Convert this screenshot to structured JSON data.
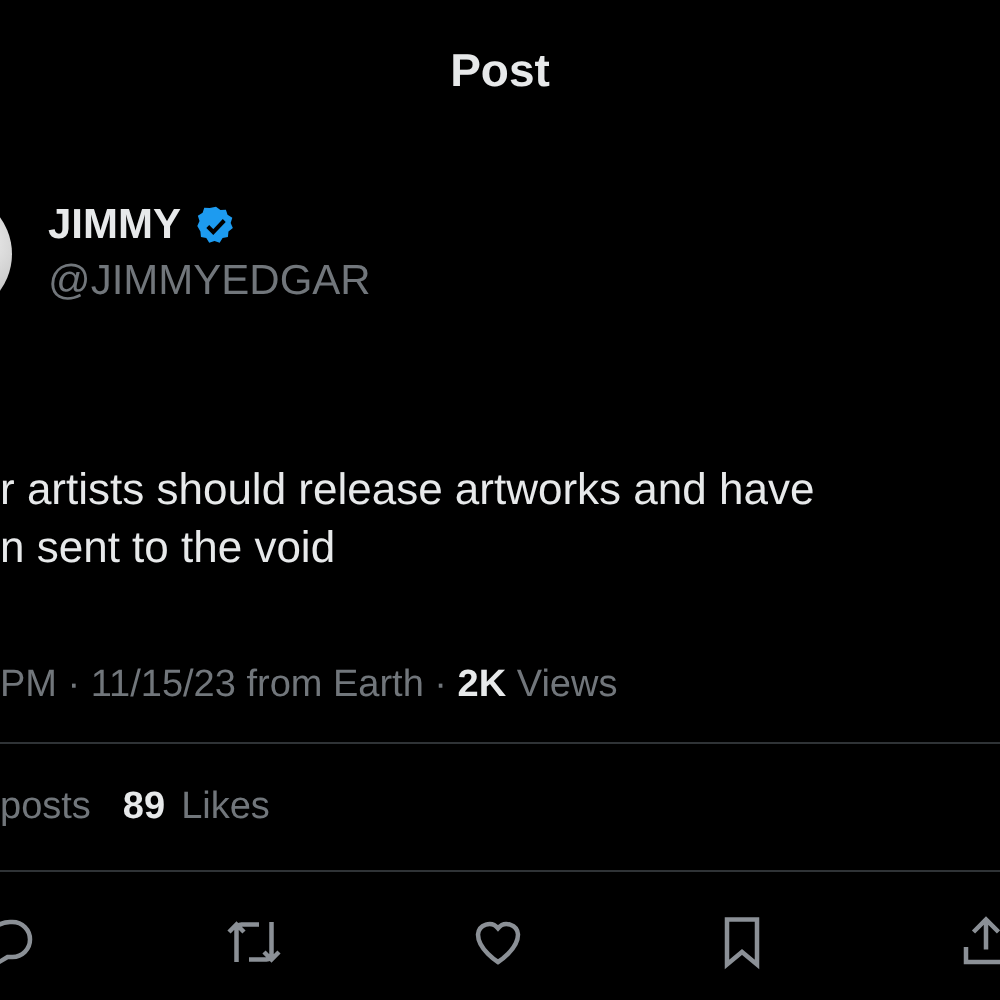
{
  "header": {
    "title": "Post"
  },
  "author": {
    "name": "JIMMY",
    "verified": true,
    "handle": "@JIMMYEDGAR"
  },
  "body": [
    "r artists should release artworks and have",
    "n sent to the void"
  ],
  "meta": {
    "time": "PM · 11/15/23 from Earth · ",
    "views_count": "2K",
    "views_label": " Views"
  },
  "stats": [
    {
      "label": "posts"
    },
    {
      "count": "89",
      "label": "Likes"
    }
  ],
  "actions": [
    {
      "kind": "reply"
    },
    {
      "kind": "repost"
    },
    {
      "kind": "like"
    },
    {
      "kind": "bookmark"
    },
    {
      "kind": "share"
    }
  ]
}
